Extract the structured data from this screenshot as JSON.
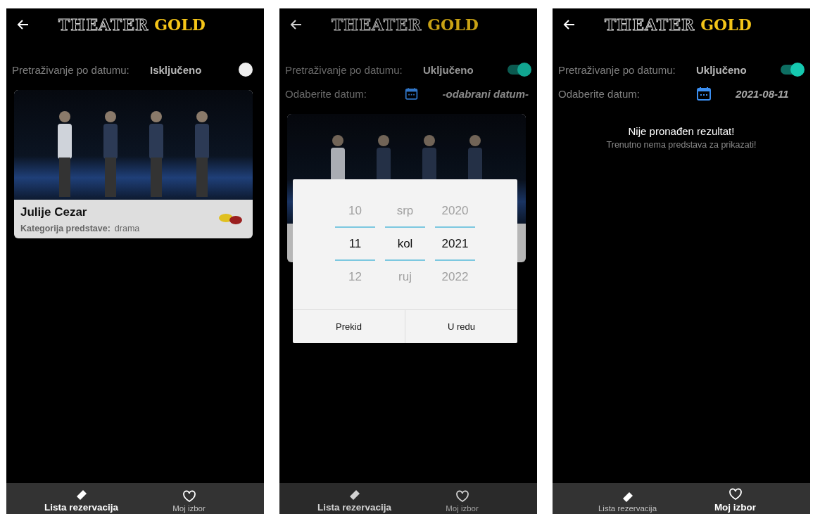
{
  "screens": [
    {
      "logo": {
        "outlined": "THEATER",
        "gold": "GOLD"
      },
      "search": {
        "label": "Pretraživanje po datumu:",
        "status": "Isključeno",
        "on": false
      },
      "shows": [
        {
          "kind": "full",
          "title": "Julije Cezar",
          "category_label": "Kategorija predstave:",
          "category": "drama"
        }
      ],
      "nav": [
        {
          "label": "Lista rezervacija",
          "selected": true
        },
        {
          "label": "Moj izbor",
          "selected": false
        }
      ]
    },
    {
      "logo": {
        "outlined": "THEATER",
        "gold": "GOLD"
      },
      "search": {
        "label": "Pretraživanje po datumu:",
        "status": "Uključeno",
        "on": true
      },
      "date": {
        "label": "Odaberite datum:",
        "value": "-odabrani datum-"
      },
      "shows": [
        {
          "kind": "covered"
        }
      ],
      "dialog": {
        "columns": [
          {
            "values": [
              {
                "text": "10",
                "selected": false
              },
              {
                "text": "11",
                "selected": true
              },
              {
                "text": "12",
                "selected": false
              }
            ]
          },
          {
            "values": [
              {
                "text": "srp",
                "selected": false
              },
              {
                "text": "kol",
                "selected": true
              },
              {
                "text": "ruj",
                "selected": false
              }
            ]
          },
          {
            "values": [
              {
                "text": "2020",
                "selected": false
              },
              {
                "text": "2021",
                "selected": true
              },
              {
                "text": "2022",
                "selected": false
              }
            ]
          }
        ],
        "buttons": [
          "Prekid",
          "U redu"
        ]
      },
      "nav": [
        {
          "label": "Lista rezervacija",
          "selected": true
        },
        {
          "label": "Moj izbor",
          "selected": false
        }
      ]
    },
    {
      "logo": {
        "outlined": "THEATER",
        "gold": "GOLD"
      },
      "search": {
        "label": "Pretraživanje po datumu:",
        "status": "Uključeno",
        "on": true
      },
      "date": {
        "label": "Odaberite datum:",
        "value": "2021-08-11"
      },
      "empty": {
        "title": "Nije pronađen rezultat!",
        "subtitle": "Trenutno nema predstava za prikazati!"
      },
      "nav": [
        {
          "label": "Lista rezervacija",
          "selected": false
        },
        {
          "label": "Moj izbor",
          "selected": true
        }
      ]
    }
  ]
}
